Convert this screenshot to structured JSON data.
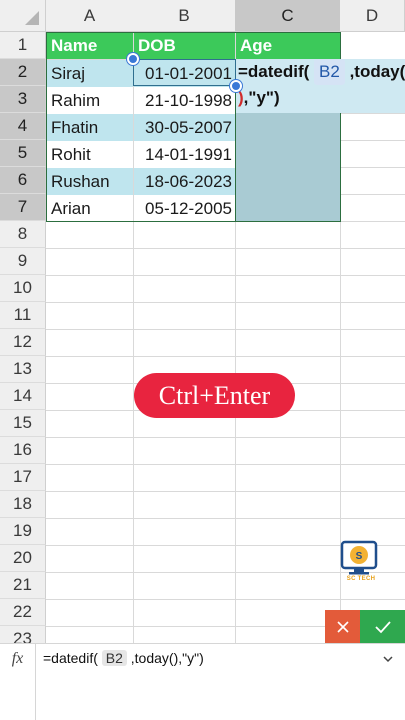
{
  "sheet": {
    "columns": [
      "A",
      "B",
      "C",
      "D"
    ],
    "rows": [
      "1",
      "2",
      "3",
      "4",
      "5",
      "6",
      "7",
      "8",
      "9",
      "10",
      "11",
      "12",
      "13",
      "14",
      "15",
      "16",
      "17",
      "18",
      "19",
      "20",
      "21",
      "22",
      "23"
    ],
    "headers": [
      "Name",
      "DOB",
      "Age"
    ],
    "data": [
      {
        "name": "Siraj",
        "dob": "01-01-2001"
      },
      {
        "name": "Rahim",
        "dob": "21-10-1998"
      },
      {
        "name": "Fhatin",
        "dob": "30-05-2007"
      },
      {
        "name": "Rohit",
        "dob": "14-01-1991"
      },
      {
        "name": "Rushan",
        "dob": "18-06-2023"
      },
      {
        "name": "Arian",
        "dob": "05-12-2005"
      }
    ]
  },
  "edit": {
    "part1": "=datedif(",
    "ref": "B2",
    "part2": ",today(",
    "paren": ")",
    "part3": ",\"y\")"
  },
  "overlay": {
    "shortcut": "Ctrl+Enter",
    "logo_text": "SC TECH"
  },
  "formula_bar": {
    "fx": "fx",
    "pre": "=datedif(",
    "ref": "B2",
    "post": ",today(),\"y\")"
  },
  "colors": {
    "header_green": "#3cc95a",
    "band_blue": "#bfe5ee",
    "selection": "#a9cbd3",
    "pill_red": "#e8243f",
    "cancel": "#e35b3a",
    "confirm": "#2fa84f"
  }
}
